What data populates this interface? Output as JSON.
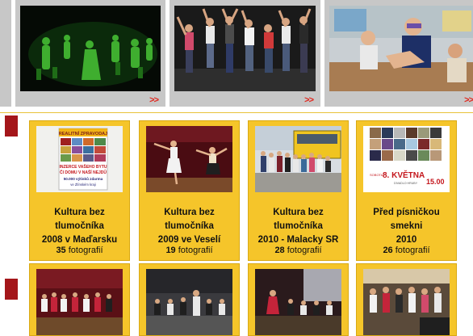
{
  "top_strip": {
    "more_label": ">>",
    "thumbs": [
      {
        "name": "video-dance-green",
        "more": ">>"
      },
      {
        "name": "video-stage-dance",
        "more": ">>"
      },
      {
        "name": "video-classroom",
        "more": ">>"
      }
    ]
  },
  "gallery": {
    "row1": [
      {
        "title_line1": "Kultura bez tlumočníka",
        "title_line2": "2008 v Maďarsku",
        "count": "35",
        "count_label": "fotografií"
      },
      {
        "title_line1": "Kultura bez tlumočníka",
        "title_line2": "2009 ve Veselí",
        "count": "19",
        "count_label": "fotografií"
      },
      {
        "title_line1": "Kultura bez tlumočníka",
        "title_line2": "2010 - Malacky SR",
        "count": "28",
        "count_label": "fotografií"
      },
      {
        "title_line1": "Před písničkou smekni",
        "title_line2": "2010",
        "count": "26",
        "count_label": "fotografií"
      }
    ],
    "thumb1_text": {
      "header": "REALITNÍ ZPRAVODAJ",
      "line1": "INZERCE VAŠEHO BYTU",
      "line2": "ČI DOMU V NAŠÍ NEJDŮ",
      "line3": "50.000 výtisků zdarma",
      "line4": "ve Zlínském kraji"
    },
    "thumb4_text": {
      "left": "SOBOTA",
      "date": "8. KVĚTNA",
      "venue": "DIVADLO HRUBY",
      "time": "15.00"
    }
  },
  "colors": {
    "accent_yellow": "#f5c52a",
    "marker_red": "#a4161a",
    "arrow_red": "#e2231a"
  }
}
